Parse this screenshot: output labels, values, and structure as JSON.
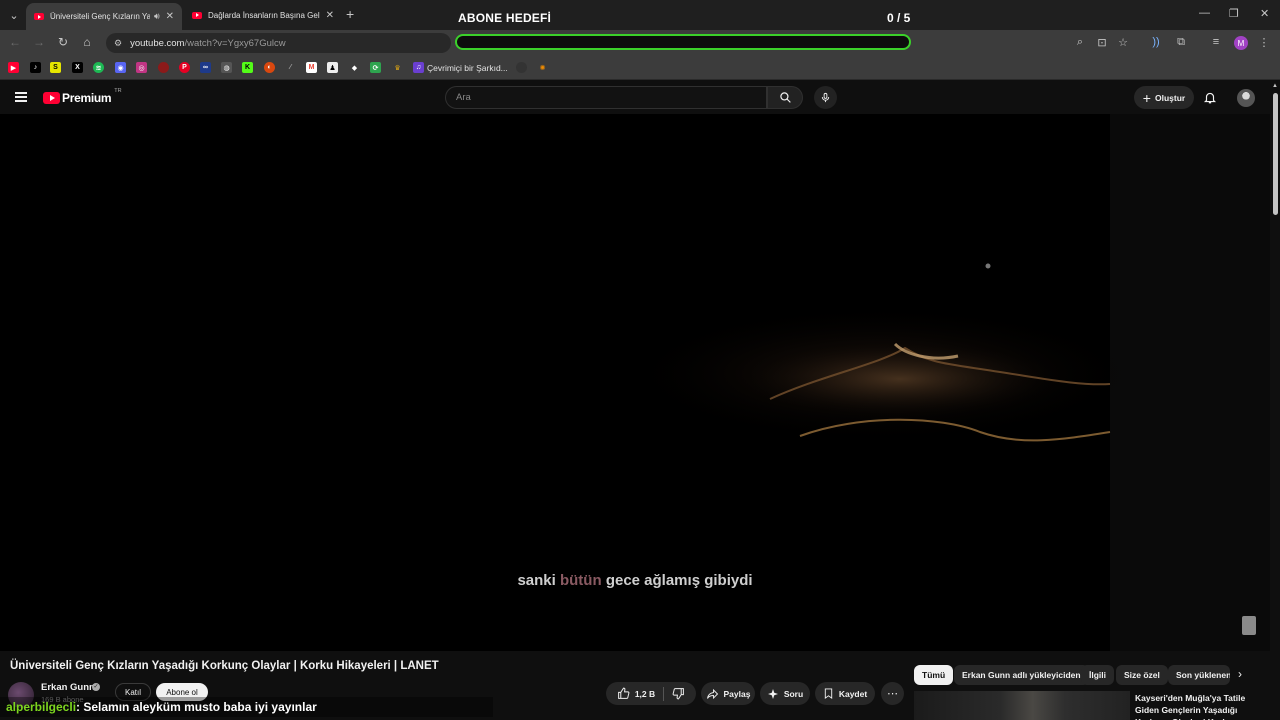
{
  "browser": {
    "tabs": [
      {
        "title": "Üniversiteli Genç Kızların Yaşa",
        "active": true
      },
      {
        "title": "Dağlarda İnsanların Başına Gele",
        "active": false
      }
    ],
    "url_host": "youtube.com",
    "url_path": "/watch?v=Ygxy67Gulcw",
    "profile_initial": "M",
    "bookmark_label": "Çevrimiçi bir Şarkıd..."
  },
  "overlay": {
    "goal_title": "ABONE HEDEFİ",
    "goal_count": "0 / 5",
    "goal_progress": 0,
    "goal_color": "#3bd12a"
  },
  "masthead": {
    "logo_word": "Premium",
    "logo_country": "TR",
    "search_placeholder": "Ara",
    "create_label": "Oluştur"
  },
  "player": {
    "subtitle_before": "sanki",
    "subtitle_highlight": "bütün",
    "subtitle_after": "gece ağlamış gibiydi"
  },
  "video": {
    "title": "Üniversiteli Genç Kızların Yaşadığı Korkunç Olaylar | Korku Hikayeleri | LANET",
    "channel": "Erkan Gunn",
    "subscribers": "169 B abone",
    "join_label": "Katıl",
    "subscribe_label": "Abone ol",
    "likes": "1,2 B",
    "share_label": "Paylaş",
    "ask_label": "Soru",
    "save_label": "Kaydet"
  },
  "chat": {
    "user": "alperbilgecli",
    "message": ": Selamın aleyküm musto baba iyi yayınlar"
  },
  "chips": [
    "Tümü",
    "Erkan Gunn adlı yükleyiciden",
    "İlgili",
    "Size özel",
    "Son yüklenenler"
  ],
  "recommended": {
    "title": "Kayseri'den Muğla'ya Tatile Giden Gençlerin Yaşadığı Korkunç Olaylar | Korku Hikayeleri"
  },
  "colors": {
    "yt_red": "#ff0033",
    "chat_user": "#7dd61f",
    "subtitle_highlight": "#8a5a62"
  }
}
